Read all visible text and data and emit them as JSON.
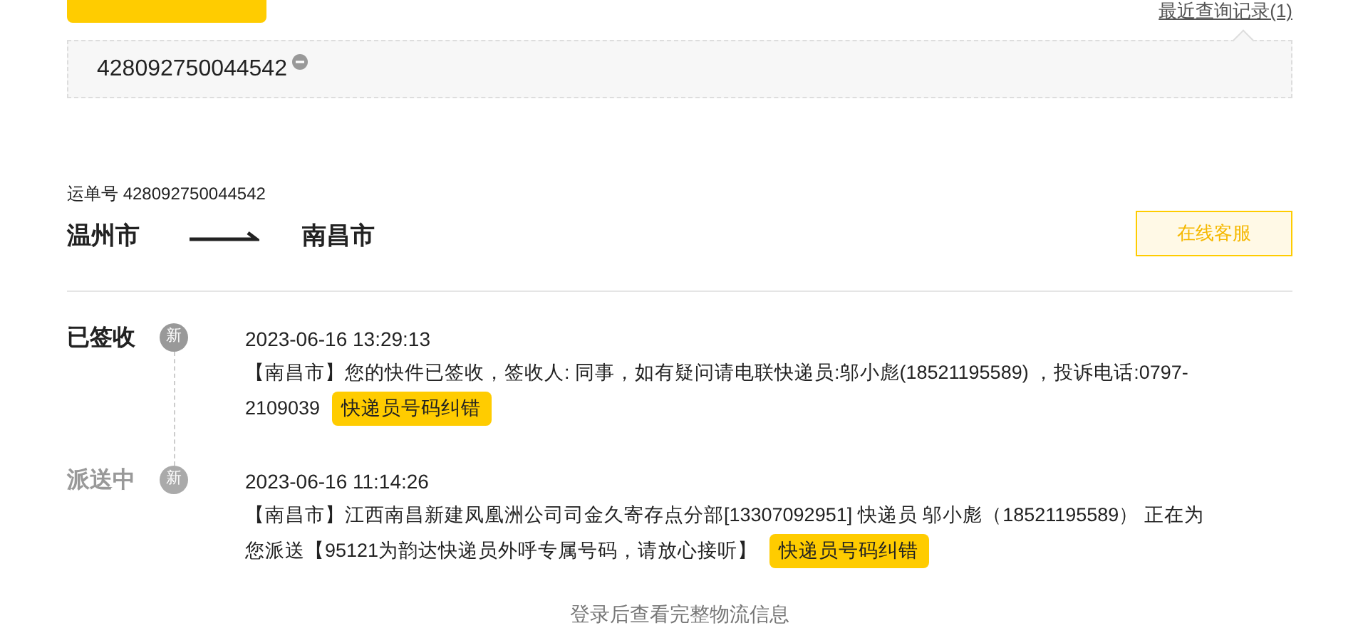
{
  "recent_link": "最近查询记录(1)",
  "tracking_number": "428092750044542",
  "waybill": "运单号 428092750044542",
  "origin": "温州市",
  "destination": "南昌市",
  "service_button": "在线客服",
  "events": [
    {
      "status": "已签收",
      "current": true,
      "badge": "新",
      "time": "2023-06-16 13:29:13",
      "description": "【南昌市】您的快件已签收，签收人: 同事，如有疑问请电联快递员:邬小彪(18521195589) ，投诉电话:0797-2109039",
      "correction_button": "快递员号码纠错"
    },
    {
      "status": "派送中",
      "current": false,
      "badge": "新",
      "time": "2023-06-16 11:14:26",
      "description": "【南昌市】江西南昌新建凤凰洲公司司金久寄存点分部[13307092951] 快递员 邬小彪（18521195589） 正在为您派送【95121为韵达快递员外呼专属号码，请放心接听】",
      "correction_button": "快递员号码纠错"
    }
  ],
  "footer": "登录后查看完整物流信息"
}
